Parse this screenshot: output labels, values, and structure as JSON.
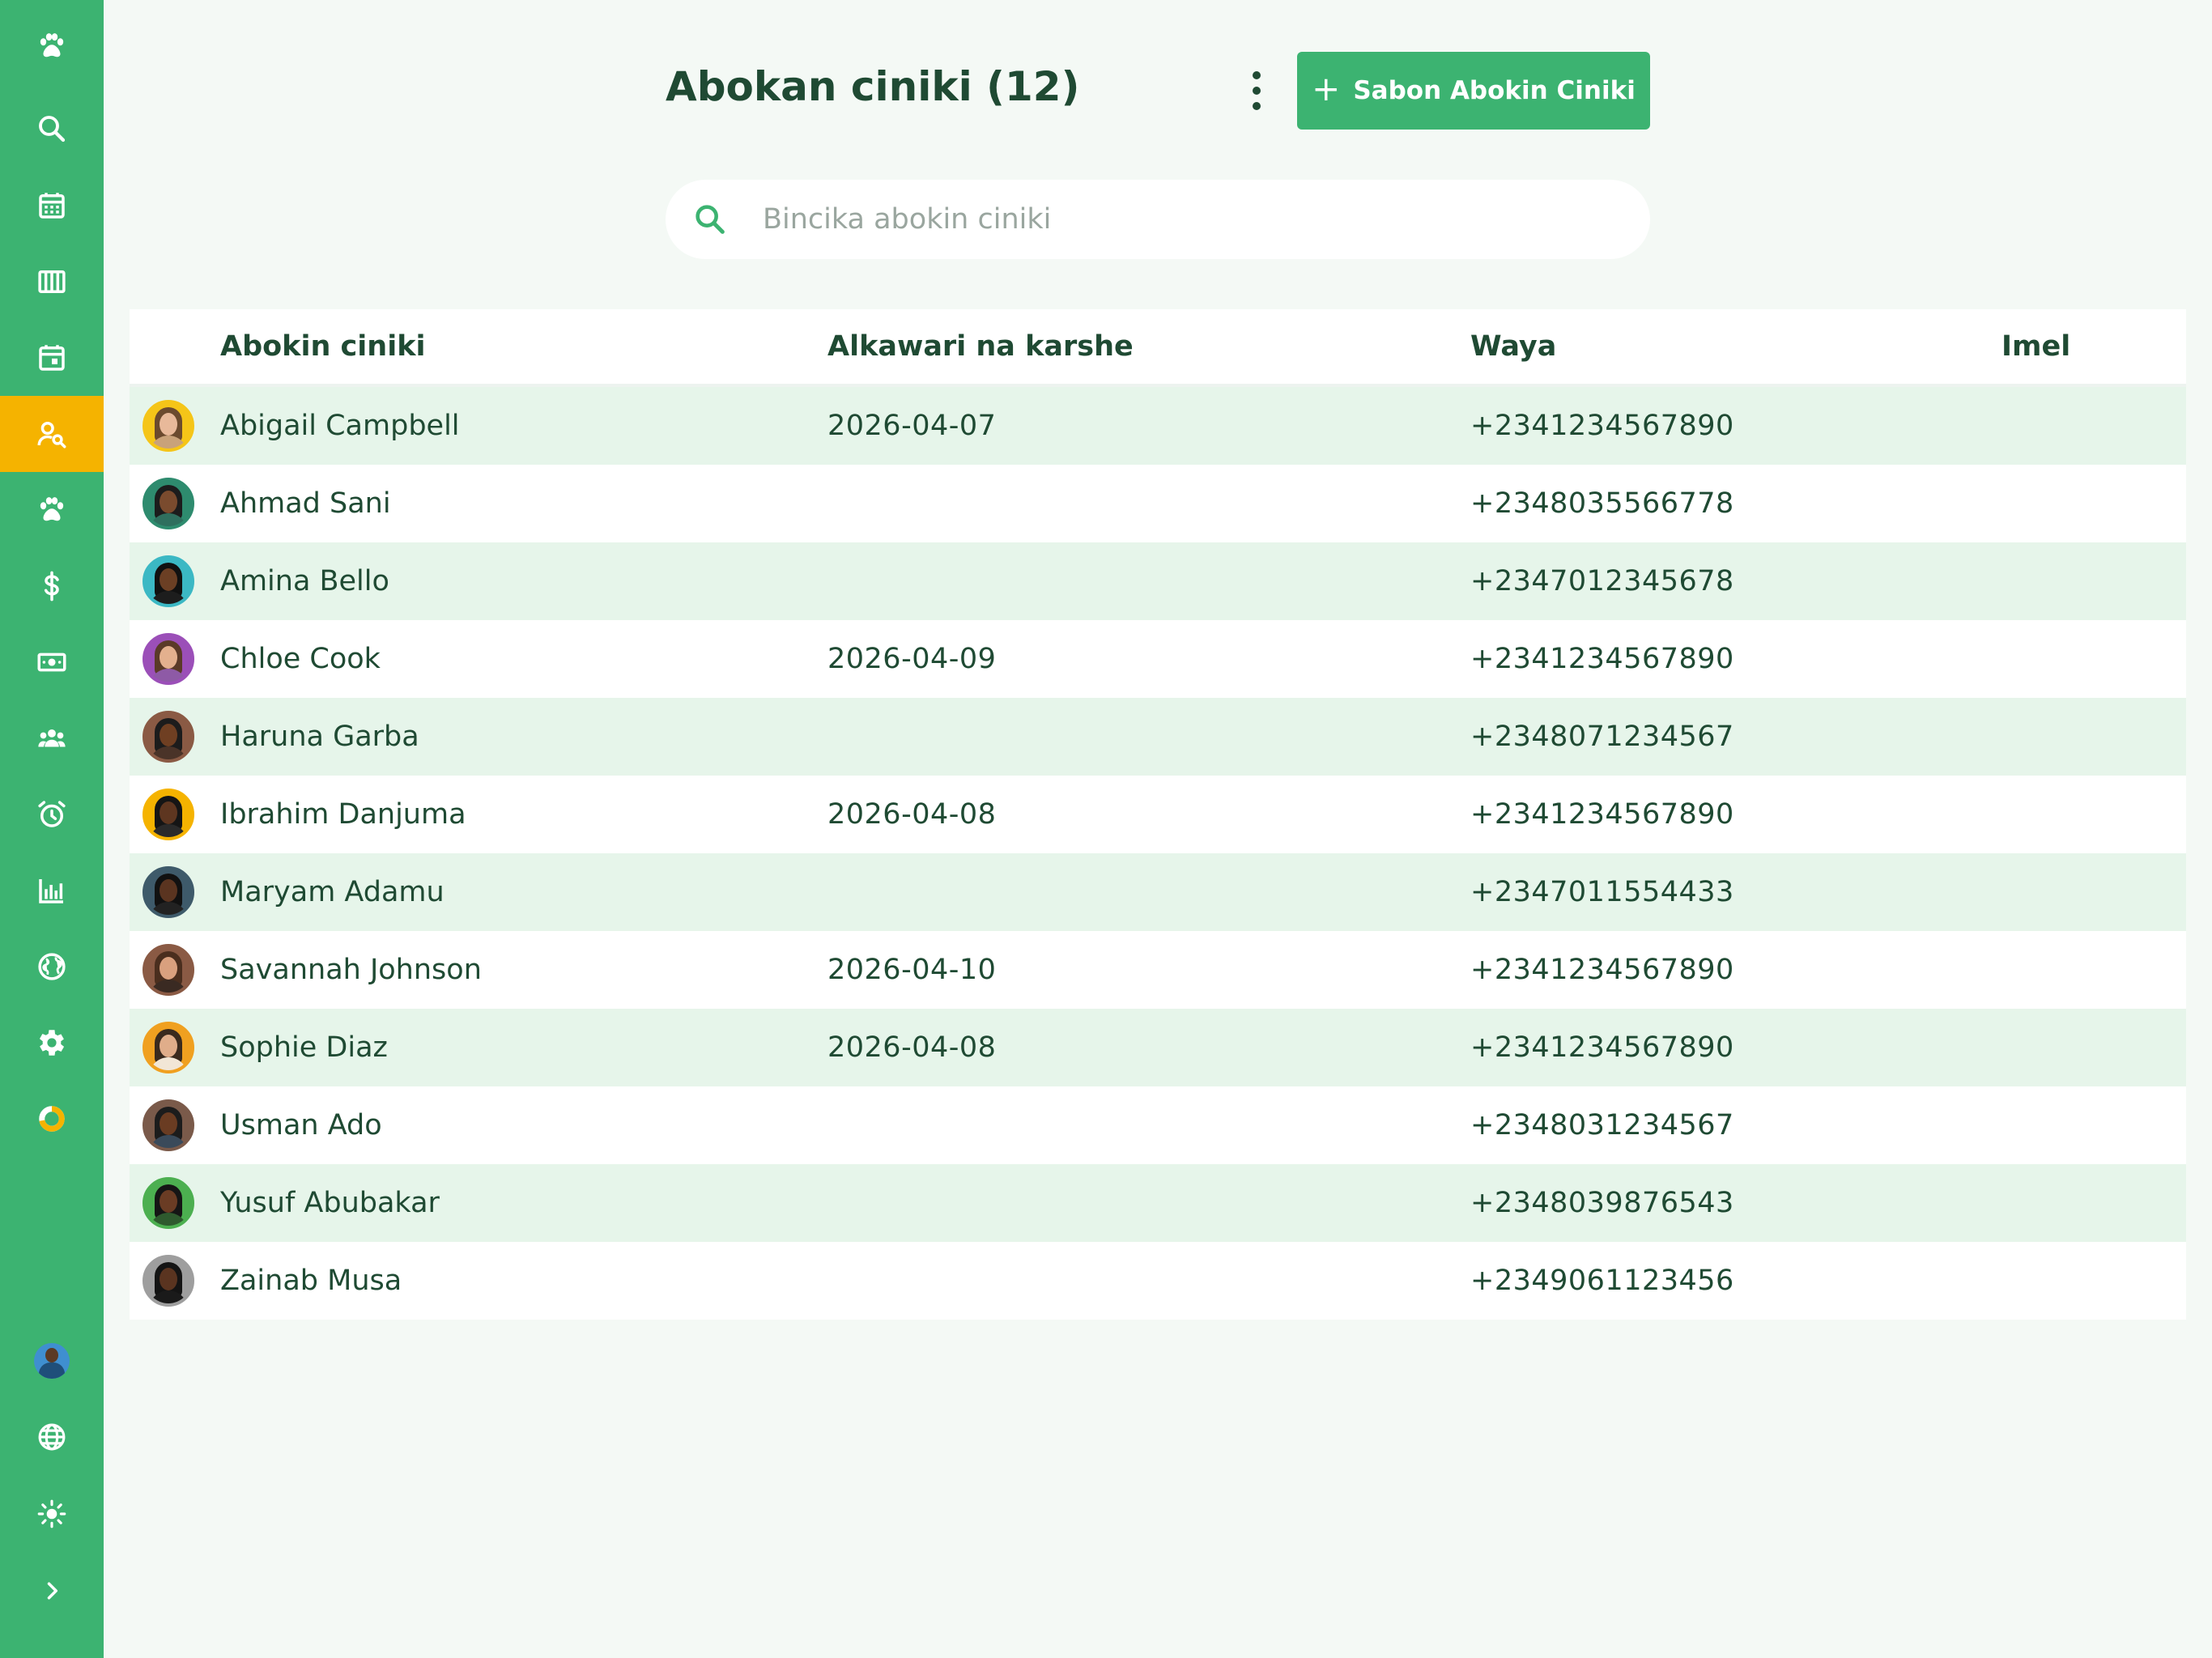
{
  "header": {
    "title": "Abokan ciniki (12)",
    "add_button_label": "Sabon Abokin Ciniki"
  },
  "search": {
    "placeholder": "Bincika abokin ciniki",
    "value": ""
  },
  "sidebar": {
    "items": [
      {
        "icon": "paw-icon",
        "active": false
      },
      {
        "icon": "search-icon",
        "active": false
      },
      {
        "icon": "calendar-grid-icon",
        "active": false
      },
      {
        "icon": "columns-icon",
        "active": false
      },
      {
        "icon": "calendar-event-icon",
        "active": false
      },
      {
        "icon": "user-search-icon",
        "active": true
      },
      {
        "icon": "paw-icon",
        "active": false
      },
      {
        "icon": "dollar-icon",
        "active": false
      },
      {
        "icon": "cash-icon",
        "active": false
      },
      {
        "icon": "group-icon",
        "active": false
      },
      {
        "icon": "alarm-clock-icon",
        "active": false
      },
      {
        "icon": "bar-chart-icon",
        "active": false
      },
      {
        "icon": "globe-filled-icon",
        "active": false
      },
      {
        "icon": "gear-icon",
        "active": false
      },
      {
        "icon": "donut-icon",
        "active": false
      }
    ],
    "bottom": [
      {
        "icon": "user-avatar"
      },
      {
        "icon": "globe-icon"
      },
      {
        "icon": "sun-icon"
      },
      {
        "icon": "chevron-right-icon"
      }
    ]
  },
  "table": {
    "columns": [
      "Abokin ciniki",
      "Alkawari na karshe",
      "Waya",
      "Imel"
    ],
    "rows": [
      {
        "name": "Abigail Campbell",
        "date": "2026-04-07",
        "phone": "+2341234567890",
        "email": "",
        "ring": "#f5c518",
        "hair": "#6b4a2e",
        "skin": "#e8b99a",
        "shirt": "#c9a27a"
      },
      {
        "name": "Ahmad Sani",
        "date": "",
        "phone": "+2348035566778",
        "email": "",
        "ring": "#2e8b6e",
        "hair": "#1c1c1c",
        "skin": "#7a4b2e",
        "shirt": "#2f6f5e"
      },
      {
        "name": "Amina Bello",
        "date": "",
        "phone": "+2347012345678",
        "email": "",
        "ring": "#3bb8c4",
        "hair": "#111111",
        "skin": "#6b3f24",
        "shirt": "#1d1d1d"
      },
      {
        "name": "Chloe Cook",
        "date": "2026-04-09",
        "phone": "+2341234567890",
        "email": "",
        "ring": "#9b4fb8",
        "hair": "#5a3a28",
        "skin": "#e3b08e",
        "shirt": "#8e5aa6"
      },
      {
        "name": "Haruna Garba",
        "date": "",
        "phone": "+2348071234567",
        "email": "",
        "ring": "#8a5a44",
        "hair": "#1c1c1c",
        "skin": "#6f3f22",
        "shirt": "#4a3328"
      },
      {
        "name": "Ibrahim Danjuma",
        "date": "2026-04-08",
        "phone": "+2341234567890",
        "email": "",
        "ring": "#f5b300",
        "hair": "#151515",
        "skin": "#5e3620",
        "shirt": "#2a2a2a"
      },
      {
        "name": "Maryam Adamu",
        "date": "",
        "phone": "+2347011554433",
        "email": "",
        "ring": "#3e5a6a",
        "hair": "#111111",
        "skin": "#5a3420",
        "shirt": "#222222"
      },
      {
        "name": "Savannah Johnson",
        "date": "2026-04-10",
        "phone": "+2341234567890",
        "email": "",
        "ring": "#8a5a44",
        "hair": "#4a2e1e",
        "skin": "#d9a07e",
        "shirt": "#3a2a22"
      },
      {
        "name": "Sophie Diaz",
        "date": "2026-04-08",
        "phone": "+2341234567890",
        "email": "",
        "ring": "#f0a020",
        "hair": "#3a2a1e",
        "skin": "#e0ad8a",
        "shirt": "#f2e6d6"
      },
      {
        "name": "Usman Ado",
        "date": "",
        "phone": "+2348031234567",
        "email": "",
        "ring": "#7a5a4a",
        "hair": "#1c1c1c",
        "skin": "#6a3c22",
        "shirt": "#3a4a5a"
      },
      {
        "name": "Yusuf Abubakar",
        "date": "",
        "phone": "+2348039876543",
        "email": "",
        "ring": "#4caf50",
        "hair": "#151515",
        "skin": "#6a3c24",
        "shirt": "#2e5a2e"
      },
      {
        "name": "Zainab Musa",
        "date": "",
        "phone": "+2349061123456",
        "email": "",
        "ring": "#9e9e9e",
        "hair": "#141414",
        "skin": "#5a3420",
        "shirt": "#1a1a1a"
      }
    ]
  },
  "colors": {
    "sidebar": "#3cb371",
    "active_nav": "#f5b300",
    "accent": "#3cb371",
    "text": "#1f4a33",
    "row_stripe": "#e6f5ea",
    "background": "#f4f9f5"
  }
}
